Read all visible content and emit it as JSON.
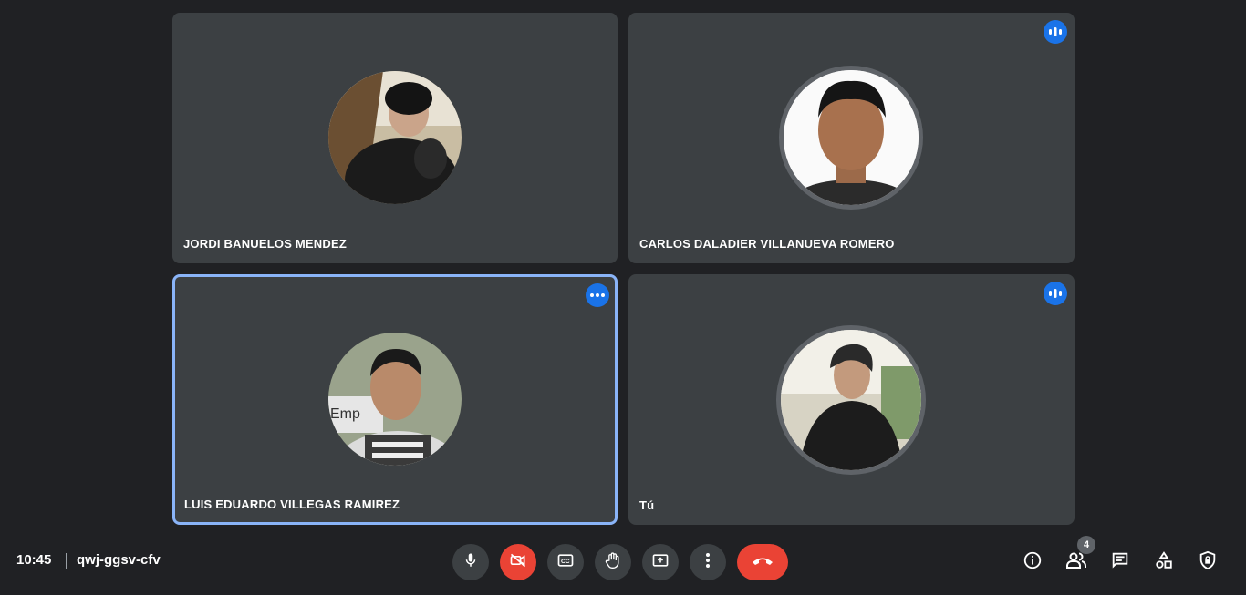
{
  "participants": [
    {
      "name": "JORDI BANUELOS MENDEZ"
    },
    {
      "name": "CARLOS DALADIER VILLANUEVA ROMERO"
    },
    {
      "name": "LUIS EDUARDO VILLEGAS RAMIREZ"
    },
    {
      "name": "Tú"
    }
  ],
  "footer": {
    "time": "10:45",
    "meeting_code": "qwj-ggsv-cfv",
    "participant_count": "4"
  },
  "colors": {
    "background": "#202124",
    "tile": "#3c4043",
    "accent": "#1a73e8",
    "active_border": "#8ab4f8",
    "danger": "#ea4335"
  },
  "icons": {
    "controls": [
      "microphone-icon",
      "camera-off-icon",
      "captions-icon",
      "raise-hand-icon",
      "present-screen-icon",
      "more-options-icon",
      "hang-up-icon"
    ],
    "right": [
      "info-icon",
      "people-icon",
      "chat-icon",
      "activities-icon",
      "host-controls-icon"
    ]
  }
}
